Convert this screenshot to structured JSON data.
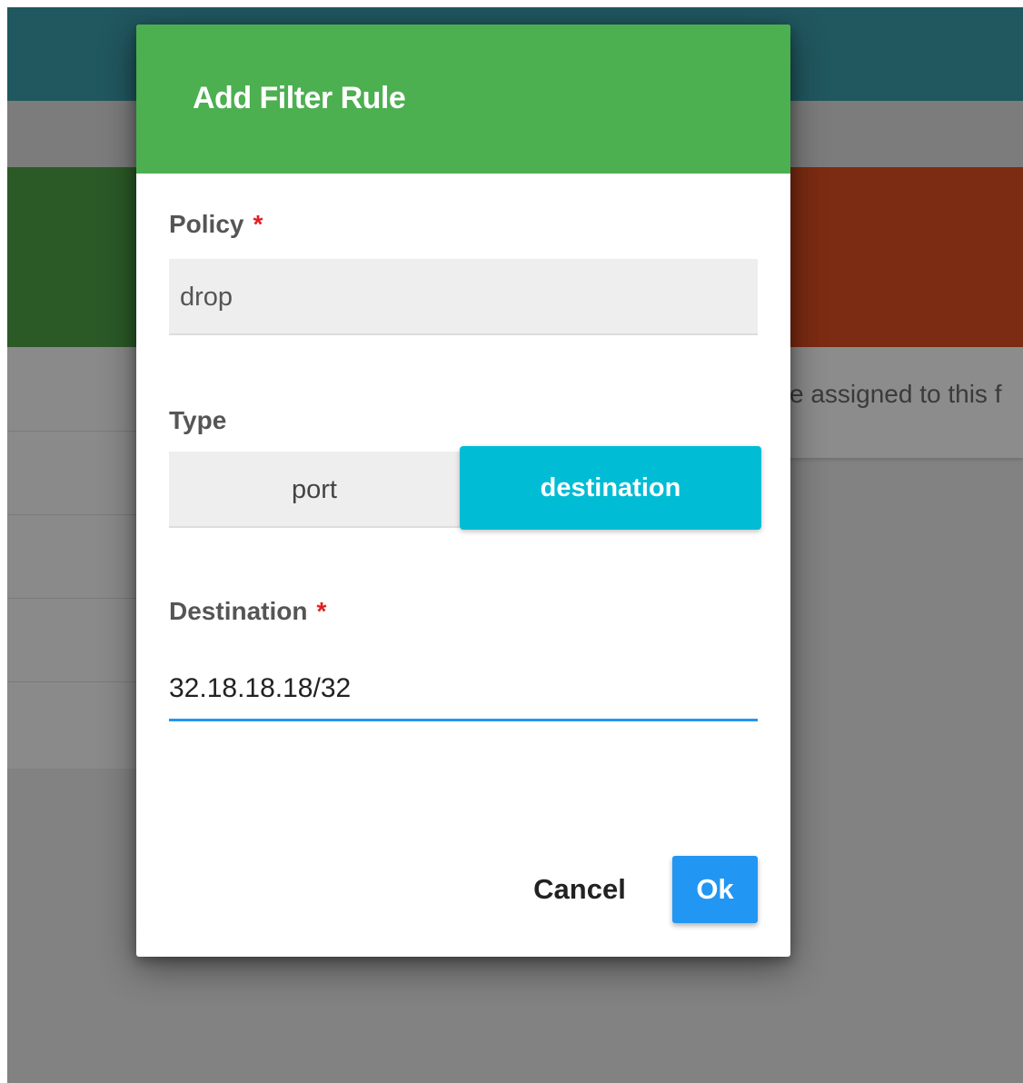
{
  "background": {
    "panel_text": "e assigned to this f",
    "colors": {
      "header": "#21575f",
      "green_card": "#2b5a27",
      "orange_card": "#7c2c12"
    }
  },
  "dialog": {
    "title": "Add Filter Rule",
    "header_color": "#4caf50",
    "policy": {
      "label": "Policy",
      "required_mark": "*",
      "value": "drop"
    },
    "type": {
      "label": "Type",
      "options": [
        "port",
        "destination"
      ],
      "selected": "destination",
      "active_color": "#00bcd4"
    },
    "destination": {
      "label": "Destination",
      "required_mark": "*",
      "value": "32.18.18.18/32"
    },
    "buttons": {
      "cancel": "Cancel",
      "ok": "Ok",
      "ok_color": "#2196f3"
    }
  }
}
